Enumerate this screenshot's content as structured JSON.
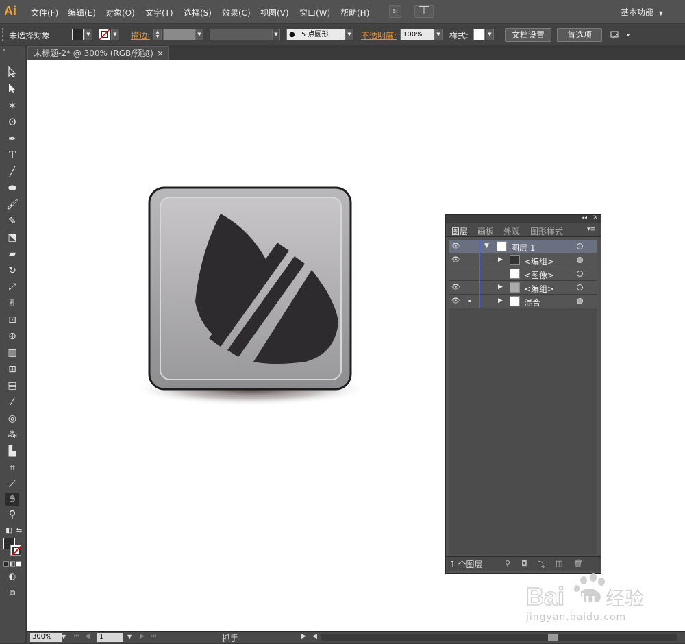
{
  "app": {
    "logo": "Ai"
  },
  "menu": [
    "文件(F)",
    "编辑(E)",
    "对象(O)",
    "文字(T)",
    "选择(S)",
    "效果(C)",
    "视图(V)",
    "窗口(W)",
    "帮助(H)"
  ],
  "menubar": {
    "bridge_label": "Br",
    "workspace": "基本功能"
  },
  "control": {
    "selection": "未选择对象",
    "stroke_label": "描边:",
    "brush": "5 点圆形",
    "opacity_label": "不透明度:",
    "opacity": "100%",
    "style_label": "样式:",
    "doc_setup": "文档设置",
    "preferences": "首选项"
  },
  "document": {
    "tab": "未标题-2* @ 300% (RGB/预览)",
    "close": "×"
  },
  "layers_panel": {
    "tabs": [
      "图层",
      "画板",
      "外观",
      "图形样式"
    ],
    "layers": [
      {
        "name": "图层 1",
        "visible": true,
        "locked": false,
        "expanded": true,
        "level": 0
      },
      {
        "name": "<编组>",
        "visible": true,
        "locked": false,
        "expanded": false,
        "level": 1
      },
      {
        "name": "<图像>",
        "visible": false,
        "locked": false,
        "expanded": false,
        "level": 1
      },
      {
        "name": "<编组>",
        "visible": true,
        "locked": false,
        "expanded": false,
        "level": 1
      },
      {
        "name": "混合",
        "visible": true,
        "locked": true,
        "expanded": false,
        "level": 1
      }
    ],
    "count": "1 个图层"
  },
  "status": {
    "zoom": "300%",
    "artboard": "1",
    "tool": "抓手"
  },
  "watermark": {
    "brand": "Bai du 经验",
    "url": "jingyan.baidu.com"
  },
  "colors": {
    "accent": "#f0a22b",
    "layer_color": "#4a6ad0",
    "icon_dark": "#2d2b2d"
  }
}
